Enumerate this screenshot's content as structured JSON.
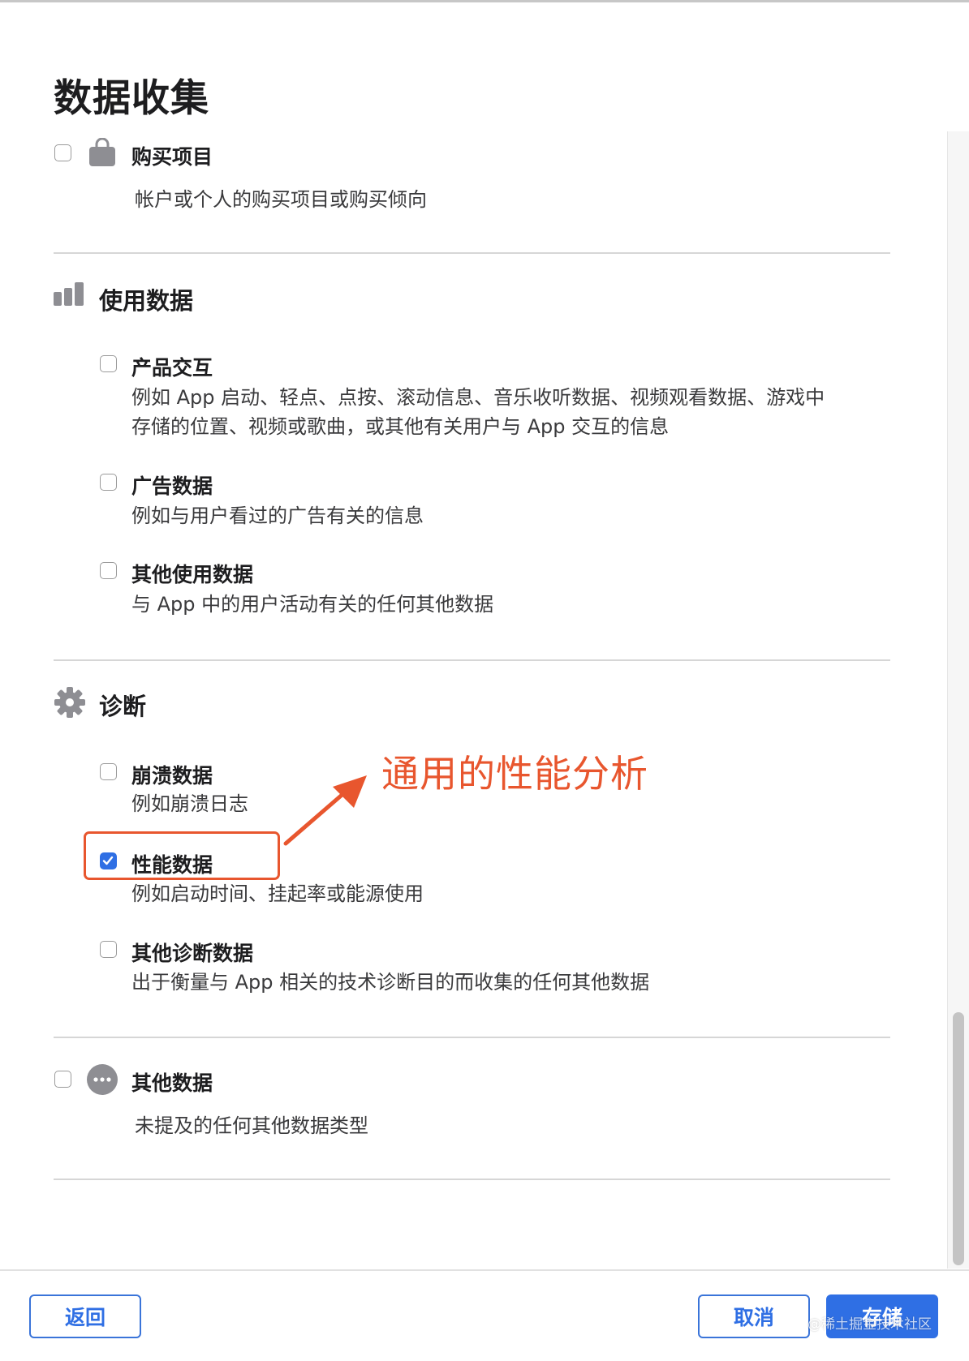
{
  "title": "数据收集",
  "purchases": {
    "label": "购买项目",
    "desc": "帐户或个人的购买项目或购买倾向",
    "checked": false,
    "icon": "shopping-bag-icon"
  },
  "usage": {
    "section_label": "使用数据",
    "icon": "bar-chart-icon",
    "items": [
      {
        "label": "产品交互",
        "desc_lines": [
          "例如 App 启动、轻点、点按、滚动信息、音乐收听数据、视频观看数据、游戏中",
          "存储的位置、视频或歌曲，或其他有关用户与 App 交互的信息"
        ],
        "checked": false
      },
      {
        "label": "广告数据",
        "desc_lines": [
          "例如与用户看过的广告有关的信息"
        ],
        "checked": false
      },
      {
        "label": "其他使用数据",
        "desc_lines": [
          "与 App 中的用户活动有关的任何其他数据"
        ],
        "checked": false
      }
    ]
  },
  "diagnostics": {
    "section_label": "诊断",
    "icon": "gear-icon",
    "items": [
      {
        "label": "崩溃数据",
        "desc_lines": [
          "例如崩溃日志"
        ],
        "checked": false
      },
      {
        "label": "性能数据",
        "desc_lines": [
          "例如启动时间、挂起率或能源使用"
        ],
        "checked": true
      },
      {
        "label": "其他诊断数据",
        "desc_lines": [
          "出于衡量与 App 相关的技术诊断目的而收集的任何其他数据"
        ],
        "checked": false
      }
    ]
  },
  "other": {
    "label": "其他数据",
    "desc": "未提及的任何其他数据类型",
    "checked": false,
    "icon": "ellipsis-circle-icon"
  },
  "annotation": {
    "text": "通用的性能分析",
    "color": "#e8562e"
  },
  "footer": {
    "back": "返回",
    "cancel": "取消",
    "save": "存储"
  },
  "watermark": "@稀土掘金技术社区",
  "colors": {
    "accent": "#2f6fe4",
    "annotation": "#e8562e"
  }
}
